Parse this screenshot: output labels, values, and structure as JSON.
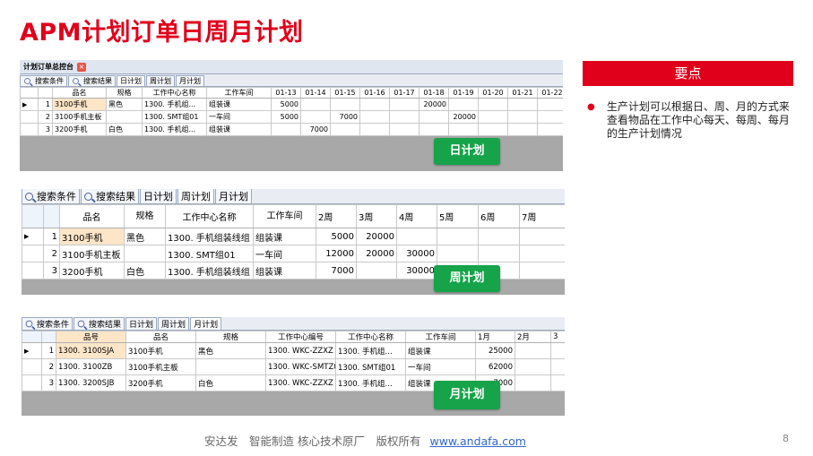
{
  "title": "APM计划订单日周月计划",
  "panel1": {
    "window_title": "计划订单总控台",
    "tabs": [
      "搜索条件",
      "搜索结果",
      "日计划",
      "周计划",
      "月计划"
    ],
    "headers": [
      "品名",
      "规格",
      "工作中心名称",
      "工作车间",
      "01-13",
      "01-14",
      "01-15",
      "01-16",
      "01-17",
      "01-18",
      "01-19",
      "01-20",
      "01-21",
      "01-22"
    ],
    "rows": [
      [
        "1",
        "3100手机",
        "黑色",
        "1300. 手机组...",
        "组装课",
        "5000",
        "",
        "",
        "",
        "",
        "20000",
        "",
        "",
        "",
        ""
      ],
      [
        "2",
        "3100手机主板",
        "",
        "1300. SMT组01",
        "一车间",
        "5000",
        "",
        "7000",
        "",
        "",
        "",
        "20000",
        "",
        "",
        ""
      ],
      [
        "3",
        "3200手机",
        "白色",
        "1300. 手机组...",
        "组装课",
        "",
        "7000",
        "",
        "",
        "",
        "",
        "",
        "",
        "",
        ""
      ]
    ],
    "badge": "日计划"
  },
  "panel2": {
    "tabs": [
      "搜索条件",
      "搜索结果",
      "日计划",
      "周计划",
      "月计划"
    ],
    "headers": [
      "品名",
      "规格",
      "工作中心名称",
      "工作车间",
      "2周",
      "3周",
      "4周",
      "5周",
      "6周",
      "7周"
    ],
    "rows": [
      [
        "1",
        "3100手机",
        "黑色",
        "1300. 手机组装线组",
        "组装课",
        "5000",
        "20000",
        "",
        "",
        "",
        ""
      ],
      [
        "2",
        "3100手机主板",
        "",
        "1300. SMT组01",
        "一车间",
        "12000",
        "20000",
        "30000",
        "",
        "",
        ""
      ],
      [
        "3",
        "3200手机",
        "白色",
        "1300. 手机组装线组",
        "组装课",
        "7000",
        "",
        "30000",
        "",
        "",
        ""
      ]
    ],
    "badge": "周计划"
  },
  "panel3": {
    "tabs": [
      "搜索条件",
      "搜索结果",
      "日计划",
      "周计划",
      "月计划"
    ],
    "headers": [
      "品号",
      "品名",
      "规格",
      "工作中心编号",
      "工作中心名称",
      "工作车间",
      "1月",
      "2月",
      "3"
    ],
    "rows": [
      [
        "1",
        "1300. 3100SJA",
        "3100手机",
        "黑色",
        "1300. WKC-ZZXZ",
        "1300. 手机组...",
        "组装课",
        "25000",
        "",
        ""
      ],
      [
        "2",
        "1300. 3100ZB",
        "3100手机主板",
        "",
        "1300. WKC-SMTZ01",
        "1300. SMT组01",
        "一车间",
        "62000",
        "",
        ""
      ],
      [
        "3",
        "1300. 3200SJB",
        "3200手机",
        "白色",
        "1300. WKC-ZZXZ",
        "1300. 手机组...",
        "组装课",
        "7000",
        "",
        ""
      ]
    ],
    "badge": "月计划"
  },
  "side": {
    "heading": "要点",
    "bullet": "生产计划可以根据日、周、月的方式来查看物品在工作中心每天、每周、每月的生产计划情况"
  },
  "footer": {
    "text": "安达发　智能制造 核心技术原厂　版权所有",
    "link": "www.andafa.com",
    "page": "8"
  },
  "colors": {
    "accent": "#e0001b",
    "badge": "#16a34a"
  }
}
